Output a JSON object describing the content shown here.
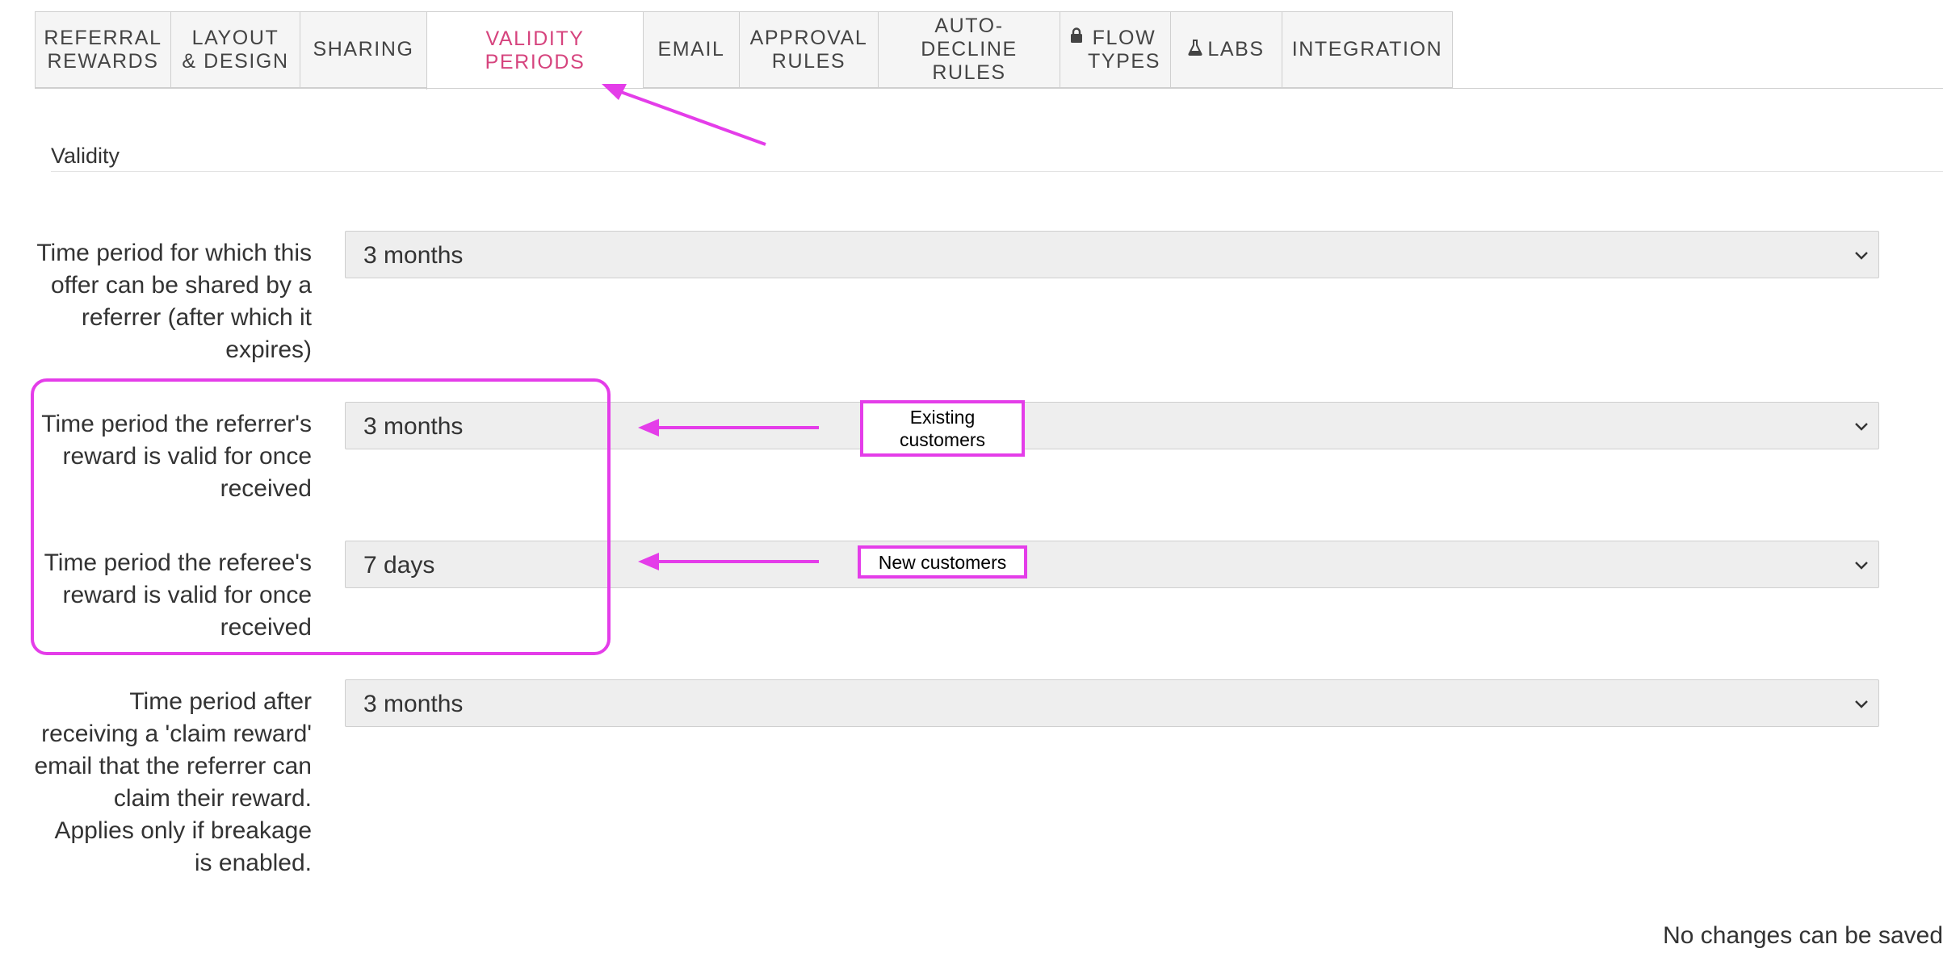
{
  "tabs": [
    {
      "label": "REFERRAL\nREWARDS",
      "active": false
    },
    {
      "label": "LAYOUT\n& DESIGN",
      "active": false
    },
    {
      "label": "SHARING",
      "active": false
    },
    {
      "label": "VALIDITY PERIODS",
      "active": true
    },
    {
      "label": "EMAIL",
      "active": false
    },
    {
      "label": "APPROVAL\nRULES",
      "active": false
    },
    {
      "label": "AUTO-DECLINE\nRULES",
      "active": false
    },
    {
      "label": "FLOW\nTYPES",
      "active": false,
      "icon": "lock-icon"
    },
    {
      "label": "LABS",
      "active": false,
      "icon": "flask-icon"
    },
    {
      "label": "INTEGRATION",
      "active": false
    }
  ],
  "section": {
    "heading": "Validity"
  },
  "fields": [
    {
      "label": "Time period for which this offer can be shared by a referrer (after which it expires)",
      "value": "3 months"
    },
    {
      "label": "Time period the referrer's reward is valid for once received",
      "value": "3 months"
    },
    {
      "label": "Time period the referee's reward is valid for once received",
      "value": "7 days"
    },
    {
      "label": "Time period after receiving a 'claim reward' email that the referrer can claim their reward. Applies only if breakage is enabled.",
      "value": "3 months"
    }
  ],
  "annotations": {
    "existing_customers": "Existing\ncustomers",
    "new_customers": "New customers",
    "color": "#e43de9"
  },
  "footer": {
    "status": "No changes can be saved"
  },
  "colors": {
    "accent": "#d6447e",
    "tab_bg": "#f5f5f5",
    "select_bg": "#eeeeee"
  }
}
